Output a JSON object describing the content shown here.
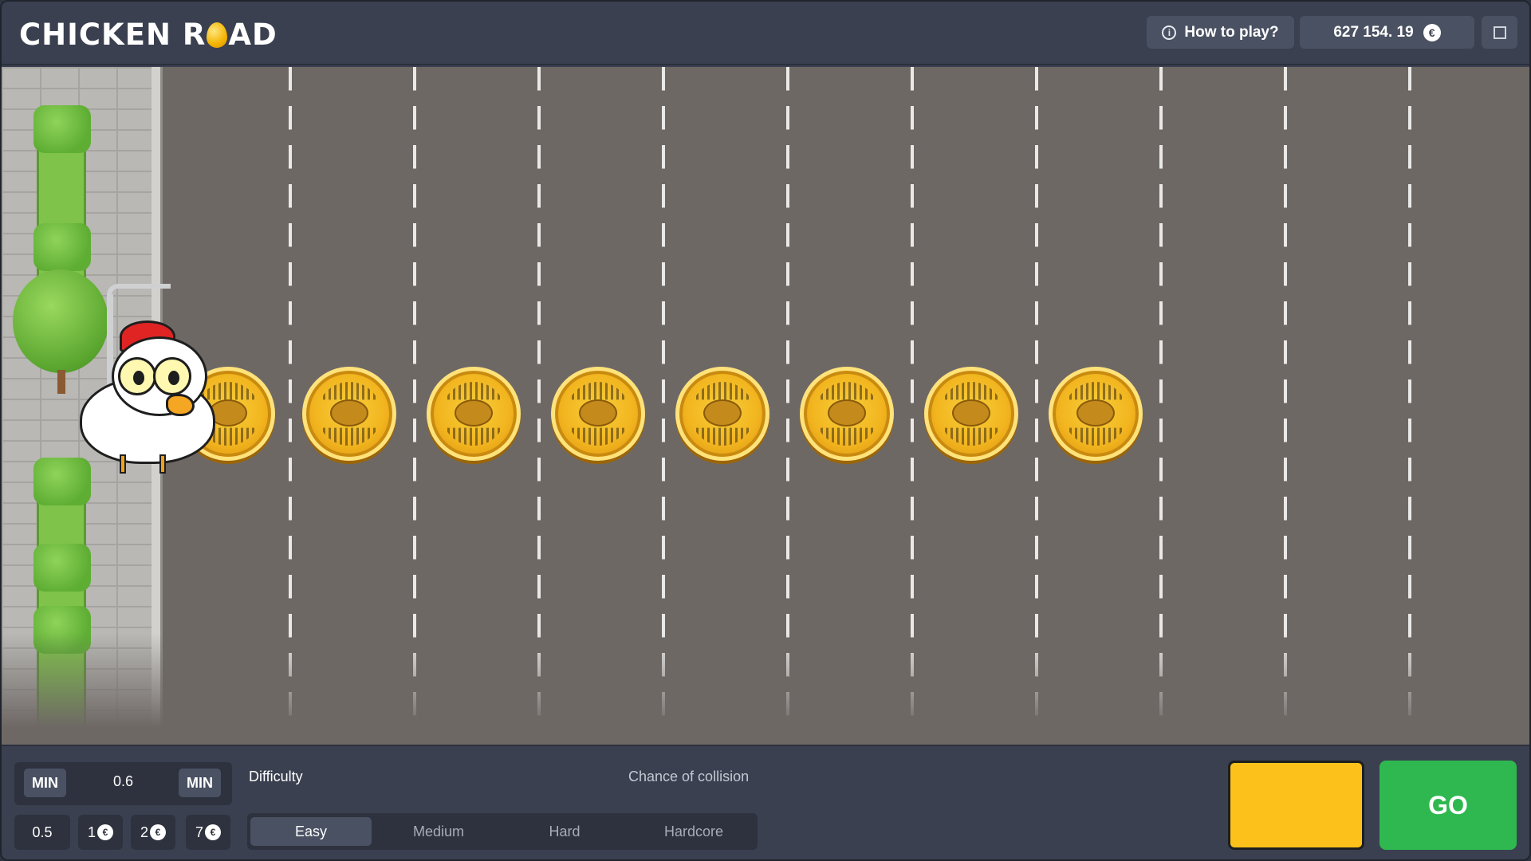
{
  "header": {
    "logo_left": "CHICKEN R",
    "logo_right": "AD",
    "how_to_play": "How to play?",
    "balance": "627 154. 19",
    "currency": "€"
  },
  "icons": {
    "info": "info-circle-icon",
    "currency": "euro-coin-icon",
    "fullscreen": "fullscreen-icon"
  },
  "game": {
    "coins": 8,
    "lanes": 10
  },
  "bet": {
    "min_label": "MIN",
    "max_label": "MIN",
    "value": "0.6",
    "chips": [
      "0.5",
      "1",
      "2",
      "7"
    ]
  },
  "difficulty": {
    "label": "Difficulty",
    "collision_label": "Chance of collision",
    "options": [
      "Easy",
      "Medium",
      "Hard",
      "Hardcore"
    ],
    "selected": "Easy"
  },
  "actions": {
    "go": "GO"
  },
  "colors": {
    "accent_yellow": "#fcc21b",
    "go_green": "#2fb84f",
    "road": "#6e6865",
    "panel": "#3a4050"
  }
}
